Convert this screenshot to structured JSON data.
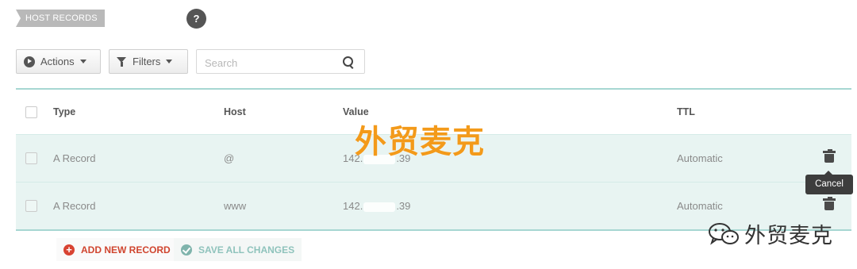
{
  "section": {
    "title": "HOST RECORDS",
    "help_glyph": "?"
  },
  "toolbar": {
    "actions_label": "Actions",
    "filters_label": "Filters",
    "search_placeholder": "Search",
    "search_value": ""
  },
  "table": {
    "columns": {
      "type": "Type",
      "host": "Host",
      "value": "Value",
      "ttl": "TTL"
    },
    "rows": [
      {
        "type": "A Record",
        "host": "@",
        "value_prefix": "142.",
        "value_suffix": ".39",
        "ttl": "Automatic"
      },
      {
        "type": "A Record",
        "host": "www",
        "value_prefix": "142.",
        "value_suffix": ".39",
        "ttl": "Automatic"
      }
    ]
  },
  "tooltip": {
    "text": "Cancel"
  },
  "bottom": {
    "add_label": "ADD NEW RECORD",
    "save_label": "SAVE ALL CHANGES",
    "add_glyph": "+"
  },
  "watermark": {
    "center_text": "外贸麦克",
    "wechat_text": "外贸麦克"
  },
  "colors": {
    "accent_teal": "#a7d7d2",
    "row_bg": "#e8f4f2",
    "add_red": "#d84332",
    "watermark_orange": "#f39a1a"
  },
  "icons": [
    "help-icon",
    "play-icon",
    "caret-down-icon",
    "funnel-icon",
    "search-icon",
    "trash-icon",
    "plus-icon",
    "check-icon",
    "wechat-icon"
  ]
}
